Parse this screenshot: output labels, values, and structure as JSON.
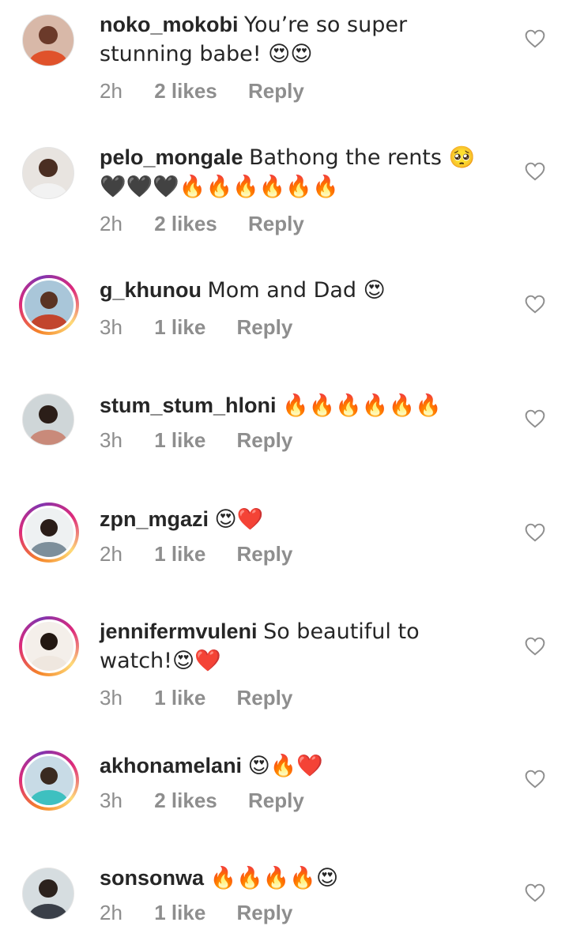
{
  "comments": [
    {
      "username": "noko_mokobi",
      "text": "You’re so super stunning babe! 😍😍",
      "time": "2h",
      "likes": "2 likes",
      "reply": "Reply",
      "story_ring": false,
      "avatar_colors": [
        "#d8b8a8",
        "#6b3a2a",
        "#e0522b"
      ]
    },
    {
      "username": "pelo_mongale",
      "text": "Bathong the rents 🥺🖤🖤🖤🔥🔥🔥🔥🔥🔥",
      "time": "2h",
      "likes": "2 likes",
      "reply": "Reply",
      "story_ring": false,
      "avatar_colors": [
        "#e8e4e0",
        "#4a2e22",
        "#f2f2f2"
      ]
    },
    {
      "username": "g_khunou",
      "text": "Mom and Dad 😍",
      "time": "3h",
      "likes": "1 like",
      "reply": "Reply",
      "story_ring": true,
      "avatar_colors": [
        "#a9c6d9",
        "#5a3322",
        "#c2452e"
      ]
    },
    {
      "username": "stum_stum_hloni",
      "text": "🔥🔥🔥🔥🔥🔥",
      "time": "3h",
      "likes": "1 like",
      "reply": "Reply",
      "story_ring": false,
      "avatar_colors": [
        "#cfd6d8",
        "#2b1e18",
        "#c98a7a"
      ]
    },
    {
      "username": "zpn_mgazi",
      "text": "😍❤️",
      "time": "2h",
      "likes": "1 like",
      "reply": "Reply",
      "story_ring": true,
      "avatar_colors": [
        "#eef1f2",
        "#2a1d18",
        "#7d8f9b"
      ]
    },
    {
      "username": "jennifermvuleni",
      "text": "So beautiful to watch!😍❤️",
      "time": "3h",
      "likes": "1 like",
      "reply": "Reply",
      "story_ring": true,
      "avatar_colors": [
        "#f4efea",
        "#231812",
        "#efe7df"
      ]
    },
    {
      "username": "akhonamelani",
      "text": "😍🔥❤️",
      "time": "3h",
      "likes": "2 likes",
      "reply": "Reply",
      "story_ring": true,
      "avatar_colors": [
        "#c8dbe6",
        "#3a2a20",
        "#3ec0c0"
      ]
    },
    {
      "username": "sonsonwa",
      "text": "🔥🔥🔥🔥😍",
      "time": "2h",
      "likes": "1 like",
      "reply": "Reply",
      "story_ring": false,
      "avatar_colors": [
        "#d6dde0",
        "#2c221d",
        "#3a3f48"
      ]
    }
  ],
  "icons": {
    "like": "heart-outline-icon"
  },
  "colors": {
    "username": "#262626",
    "meta": "#8e8e8e",
    "heart_stroke": "#8e8e8e"
  }
}
